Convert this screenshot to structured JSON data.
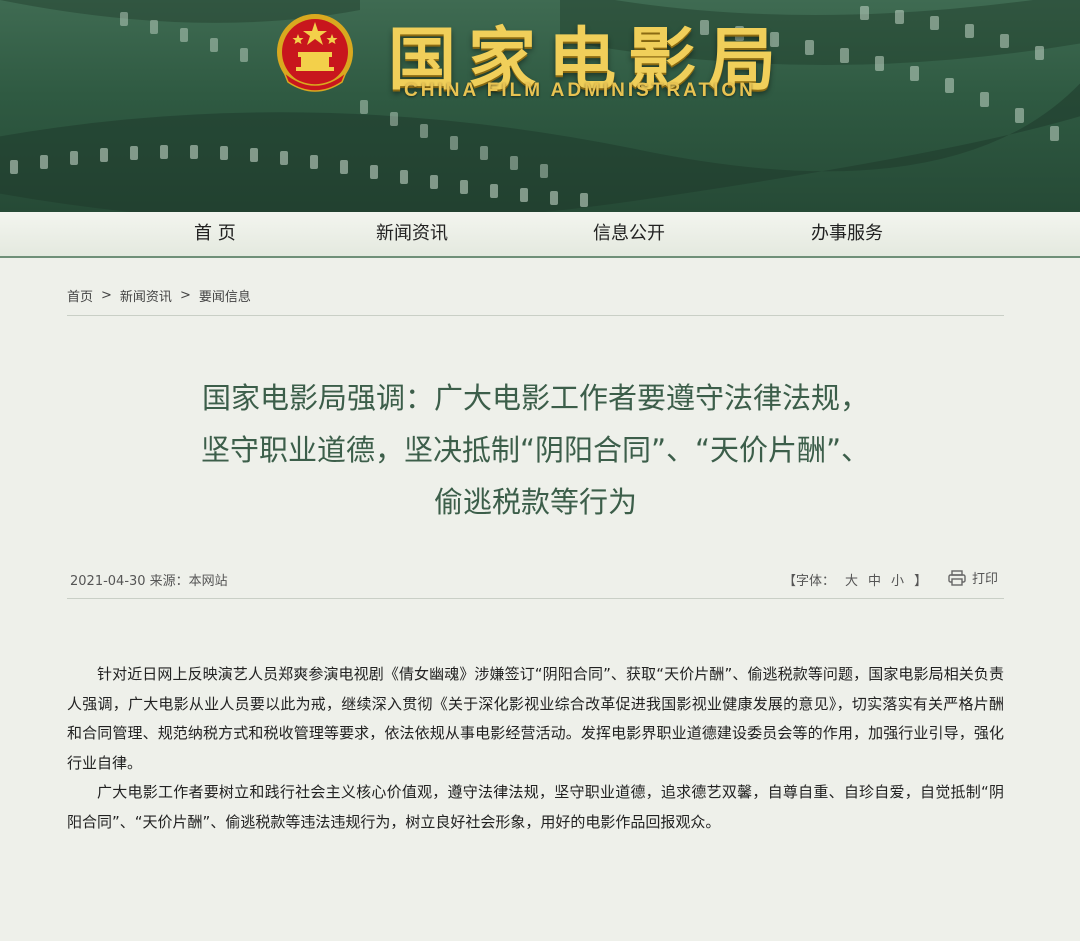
{
  "header": {
    "title": "国家电影局",
    "subtitle": "CHINA FILM ADMINISTRATION",
    "colors": {
      "banner": "#2f5a42",
      "gold": "#f0cf5a",
      "accent": "#3c5e4a"
    }
  },
  "nav": {
    "items": [
      {
        "label": "首 页"
      },
      {
        "label": "新闻资讯"
      },
      {
        "label": "信息公开"
      },
      {
        "label": "办事服务"
      }
    ]
  },
  "breadcrumb": {
    "items": [
      "首页",
      "新闻资讯",
      "要闻信息"
    ],
    "separator": ">"
  },
  "article": {
    "title_lines": [
      "国家电影局强调：广大电影工作者要遵守法律法规，",
      "坚守职业道德，坚决抵制“阴阳合同”、“天价片酬”、",
      "偷逃税款等行为"
    ],
    "meta": "2021-04-30 来源：本网站",
    "font_control": {
      "open": "【字体：",
      "large": "大",
      "medium": "中",
      "small": "小",
      "close": "】"
    },
    "print_label": "打印",
    "paragraphs": [
      "针对近日网上反映演艺人员郑爽参演电视剧《倩女幽魂》涉嫌签订“阴阳合同”、获取“天价片酬”、偷逃税款等问题，国家电影局相关负责人强调，广大电影从业人员要以此为戒，继续深入贯彻《关于深化影视业综合改革促进我国影视业健康发展的意见》，切实落实有关严格片酬和合同管理、规范纳税方式和税收管理等要求，依法依规从事电影经营活动。发挥电影界职业道德建设委员会等的作用，加强行业引导，强化行业自律。",
      "广大电影工作者要树立和践行社会主义核心价值观，遵守法律法规，坚守职业道德，追求德艺双馨，自尊自重、自珍自爱，自觉抵制“阴阳合同”、“天价片酬”、偷逃税款等违法违规行为，树立良好社会形象，用好的电影作品回报观众。"
    ]
  }
}
